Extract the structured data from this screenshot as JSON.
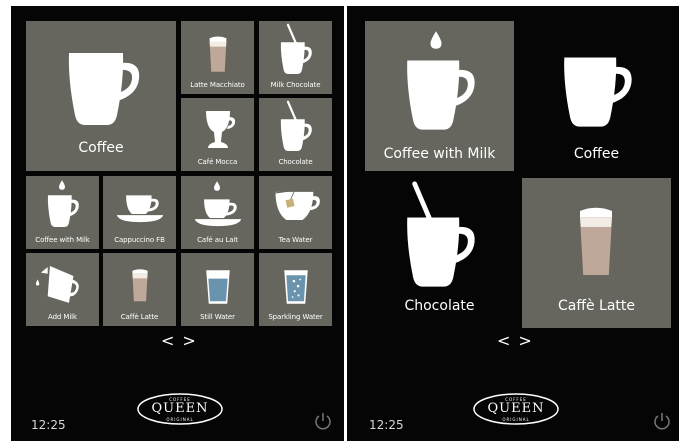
{
  "left_screen": {
    "tiles": [
      {
        "label": "Coffee",
        "icon": "large-mug-icon"
      },
      {
        "label": "Latte Macchiato",
        "icon": "latte-glass-icon"
      },
      {
        "label": "Milk Chocolate",
        "icon": "mug-with-straw-icon"
      },
      {
        "label": "Café Mocca",
        "icon": "mocca-glass-icon"
      },
      {
        "label": "Chocolate",
        "icon": "mug-with-straw-icon"
      },
      {
        "label": "Coffee with Milk",
        "icon": "mug-with-milk-drop-icon"
      },
      {
        "label": "Cappuccino FB",
        "icon": "cup-and-saucer-icon"
      },
      {
        "label": "Café au Lait",
        "icon": "cup-with-drop-icon"
      },
      {
        "label": "Tea Water",
        "icon": "tea-cup-icon"
      },
      {
        "label": "Add Milk",
        "icon": "milk-jug-icon"
      },
      {
        "label": "Caffè Latte",
        "icon": "latte-glass-icon"
      },
      {
        "label": "Still Water",
        "icon": "water-glass-icon"
      },
      {
        "label": "Sparkling Water",
        "icon": "sparkling-water-icon"
      }
    ],
    "nav_prev": "<",
    "nav_next": ">",
    "clock": "12:25",
    "logo": {
      "top": "COFFEE",
      "main": "QUEEN",
      "bottom": "ORIGINAL"
    }
  },
  "right_screen": {
    "tiles": [
      {
        "label": "Coffee with Milk",
        "icon": "mug-with-milk-drop-icon"
      },
      {
        "label": "Coffee",
        "icon": "large-mug-icon"
      },
      {
        "label": "Chocolate",
        "icon": "mug-with-straw-icon"
      },
      {
        "label": "Caffè  Latte",
        "icon": "latte-glass-icon"
      }
    ],
    "nav_prev": "<",
    "nav_next": ">",
    "clock": "12:25",
    "logo": {
      "top": "COFFEE",
      "main": "QUEEN",
      "bottom": "ORIGINAL"
    }
  },
  "colors": {
    "tile": "#66665f",
    "background": "#050505",
    "icon": "#ffffff",
    "latte": "#bfa899",
    "water": "#6a93ae"
  }
}
